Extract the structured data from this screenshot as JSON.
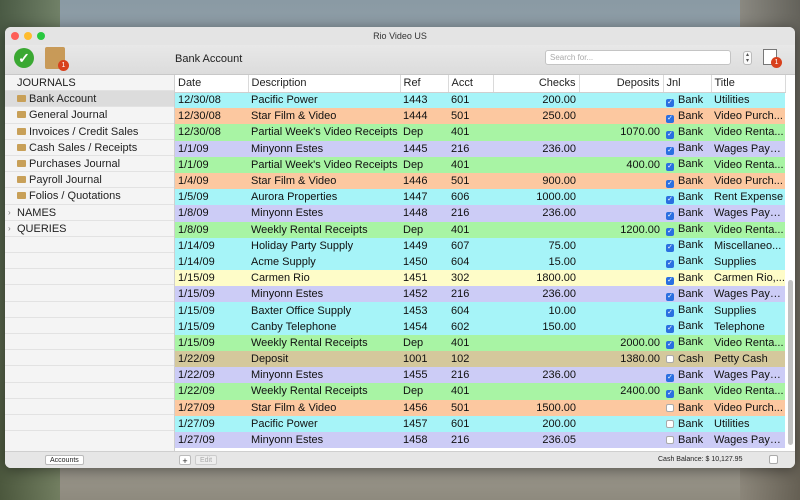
{
  "window": {
    "title": "Rio Video US"
  },
  "toolbar": {
    "account_title": "Bank Account",
    "search_placeholder": "Search for...",
    "journal_badge": "1",
    "report_badge": "1"
  },
  "sidebar": {
    "journals_label": "JOURNALS",
    "items": [
      {
        "label": "Bank Account",
        "selected": true
      },
      {
        "label": "General Journal"
      },
      {
        "label": "Invoices / Credit Sales"
      },
      {
        "label": "Cash Sales / Receipts"
      },
      {
        "label": "Purchases Journal"
      },
      {
        "label": "Payroll Journal"
      },
      {
        "label": "Folios / Quotations"
      }
    ],
    "names_label": "NAMES",
    "queries_label": "QUERIES"
  },
  "table": {
    "columns": [
      "Date",
      "Description",
      "Ref",
      "Acct",
      "Checks",
      "Deposits",
      "Jnl",
      "Title"
    ],
    "row_colors": {
      "cyan": "#a6f4f8",
      "orange": "#fcc8a0",
      "green": "#a8f4a4",
      "lavender": "#ccccf6",
      "yellow": "#fefcc8",
      "tan": "#d4c89c"
    },
    "rows": [
      {
        "date": "12/30/08",
        "desc": "Pacific Power",
        "ref": "1443",
        "acct": "601",
        "checks": "200.00",
        "deposits": "",
        "checked": true,
        "jnl": "Bank",
        "title": "Utilities",
        "color": "cyan"
      },
      {
        "date": "12/30/08",
        "desc": "Star Film & Video",
        "ref": "1444",
        "acct": "501",
        "checks": "250.00",
        "deposits": "",
        "checked": true,
        "jnl": "Bank",
        "title": "Video Purch...",
        "color": "orange"
      },
      {
        "date": "12/30/08",
        "desc": "Partial Week's Video Receipts",
        "ref": "Dep",
        "acct": "401",
        "checks": "",
        "deposits": "1070.00",
        "checked": true,
        "jnl": "Bank",
        "title": "Video Renta...",
        "color": "green"
      },
      {
        "date": "1/1/09",
        "desc": "Minyonn Estes",
        "ref": "1445",
        "acct": "216",
        "checks": "236.00",
        "deposits": "",
        "checked": true,
        "jnl": "Bank",
        "title": "Wages Paya...",
        "color": "lavender"
      },
      {
        "date": "1/1/09",
        "desc": "Partial Week's Video Receipts",
        "ref": "Dep",
        "acct": "401",
        "checks": "",
        "deposits": "400.00",
        "checked": true,
        "jnl": "Bank",
        "title": "Video Renta...",
        "color": "green"
      },
      {
        "date": "1/4/09",
        "desc": "Star Film & Video",
        "ref": "1446",
        "acct": "501",
        "checks": "900.00",
        "deposits": "",
        "checked": true,
        "jnl": "Bank",
        "title": "Video Purch...",
        "color": "orange"
      },
      {
        "date": "1/5/09",
        "desc": "Aurora Properties",
        "ref": "1447",
        "acct": "606",
        "checks": "1000.00",
        "deposits": "",
        "checked": true,
        "jnl": "Bank",
        "title": "Rent Expense",
        "color": "cyan"
      },
      {
        "date": "1/8/09",
        "desc": "Minyonn Estes",
        "ref": "1448",
        "acct": "216",
        "checks": "236.00",
        "deposits": "",
        "checked": true,
        "jnl": "Bank",
        "title": "Wages Paya...",
        "color": "lavender"
      },
      {
        "date": "1/8/09",
        "desc": "Weekly Rental Receipts",
        "ref": "Dep",
        "acct": "401",
        "checks": "",
        "deposits": "1200.00",
        "checked": true,
        "jnl": "Bank",
        "title": "Video Renta...",
        "color": "green"
      },
      {
        "date": "1/14/09",
        "desc": "Holiday Party Supply",
        "ref": "1449",
        "acct": "607",
        "checks": "75.00",
        "deposits": "",
        "checked": true,
        "jnl": "Bank",
        "title": "Miscellaneo...",
        "color": "cyan"
      },
      {
        "date": "1/14/09",
        "desc": "Acme Supply",
        "ref": "1450",
        "acct": "604",
        "checks": "15.00",
        "deposits": "",
        "checked": true,
        "jnl": "Bank",
        "title": "Supplies",
        "color": "cyan"
      },
      {
        "date": "1/15/09",
        "desc": "Carmen Rio",
        "ref": "1451",
        "acct": "302",
        "checks": "1800.00",
        "deposits": "",
        "checked": true,
        "jnl": "Bank",
        "title": "Carmen Rio,...",
        "color": "yellow"
      },
      {
        "date": "1/15/09",
        "desc": "Minyonn Estes",
        "ref": "1452",
        "acct": "216",
        "checks": "236.00",
        "deposits": "",
        "checked": true,
        "jnl": "Bank",
        "title": "Wages Paya...",
        "color": "lavender"
      },
      {
        "date": "1/15/09",
        "desc": "Baxter Office Supply",
        "ref": "1453",
        "acct": "604",
        "checks": "10.00",
        "deposits": "",
        "checked": true,
        "jnl": "Bank",
        "title": "Supplies",
        "color": "cyan"
      },
      {
        "date": "1/15/09",
        "desc": "Canby Telephone",
        "ref": "1454",
        "acct": "602",
        "checks": "150.00",
        "deposits": "",
        "checked": true,
        "jnl": "Bank",
        "title": "Telephone",
        "color": "cyan"
      },
      {
        "date": "1/15/09",
        "desc": "Weekly Rental Receipts",
        "ref": "Dep",
        "acct": "401",
        "checks": "",
        "deposits": "2000.00",
        "checked": true,
        "jnl": "Bank",
        "title": "Video Renta...",
        "color": "green"
      },
      {
        "date": "1/22/09",
        "desc": "Deposit",
        "ref": "1001",
        "acct": "102",
        "checks": "",
        "deposits": "1380.00",
        "checked": false,
        "jnl": "Cash",
        "title": "Petty Cash",
        "color": "tan"
      },
      {
        "date": "1/22/09",
        "desc": "Minyonn Estes",
        "ref": "1455",
        "acct": "216",
        "checks": "236.00",
        "deposits": "",
        "checked": true,
        "jnl": "Bank",
        "title": "Wages Paya...",
        "color": "lavender"
      },
      {
        "date": "1/22/09",
        "desc": "Weekly Rental Receipts",
        "ref": "Dep",
        "acct": "401",
        "checks": "",
        "deposits": "2400.00",
        "checked": true,
        "jnl": "Bank",
        "title": "Video Renta...",
        "color": "green"
      },
      {
        "date": "1/27/09",
        "desc": "Star Film & Video",
        "ref": "1456",
        "acct": "501",
        "checks": "1500.00",
        "deposits": "",
        "checked": false,
        "jnl": "Bank",
        "title": "Video Purch...",
        "color": "orange"
      },
      {
        "date": "1/27/09",
        "desc": "Pacific Power",
        "ref": "1457",
        "acct": "601",
        "checks": "200.00",
        "deposits": "",
        "checked": false,
        "jnl": "Bank",
        "title": "Utilities",
        "color": "cyan"
      },
      {
        "date": "1/27/09",
        "desc": "Minyonn Estes",
        "ref": "1458",
        "acct": "216",
        "checks": "236.05",
        "deposits": "",
        "checked": false,
        "jnl": "Bank",
        "title": "Wages Paya...",
        "color": "lavender"
      }
    ]
  },
  "statusbar": {
    "accounts_label": "Accounts",
    "add_label": "+",
    "edit_label": "Edit",
    "balance_label": "Cash Balance:",
    "balance_value": "$ 10,127.95"
  }
}
